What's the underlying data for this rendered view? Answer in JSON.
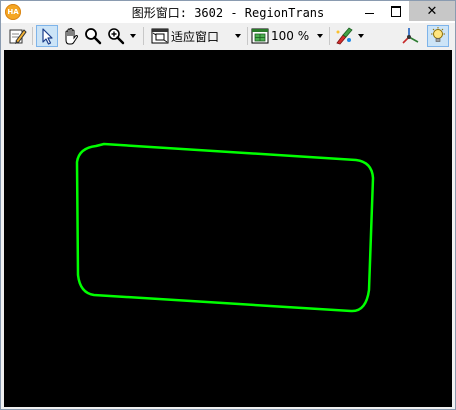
{
  "window": {
    "app_icon_text": "HA",
    "title": "图形窗口: 3602 - RegionTrans",
    "close_glyph": "✕"
  },
  "toolbar": {
    "zoom_mode_label": "适应窗口",
    "zoom_percent_label": "100 %"
  },
  "colors": {
    "canvas_background": "#000000",
    "region_outline": "#00ff00",
    "accent_selected": "#cce4f7"
  },
  "icons": {
    "app": "halcon-app-icon",
    "edit": "pencil-edit-icon",
    "select": "arrow-pointer-icon",
    "pan": "hand-pan-icon",
    "magnify": "magnifier-icon",
    "zoom_in": "zoom-in-icon",
    "fit": "fit-window-icon",
    "zoom_percent": "zoom-percent-icon",
    "paint": "paint-brush-icon",
    "axes": "coordinate-axes-icon",
    "light": "lightbulb-icon"
  }
}
